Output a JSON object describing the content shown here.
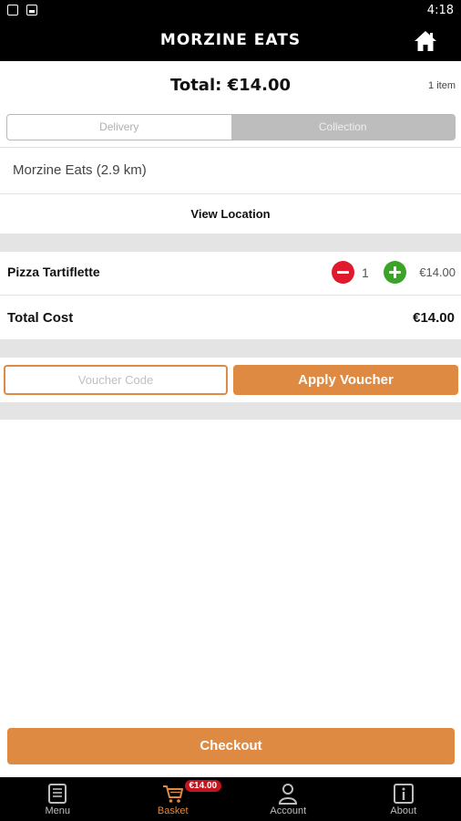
{
  "status_bar": {
    "time": "4:18"
  },
  "app_bar": {
    "title": "MORZINE EATS",
    "home_icon": "home-icon"
  },
  "summary": {
    "total_label": "Total: €14.00",
    "item_count": "1 item"
  },
  "order_type": {
    "options": [
      "Delivery",
      "Collection"
    ],
    "selected": "Collection"
  },
  "location": {
    "name": "Morzine Eats (2.9 km)",
    "view_label": "View Location"
  },
  "basket": {
    "items": [
      {
        "name": "Pizza Tartiflette",
        "quantity": "1",
        "price": "€14.00"
      }
    ],
    "total_cost_label": "Total Cost",
    "total_cost_value": "€14.00"
  },
  "voucher": {
    "placeholder": "Voucher Code",
    "apply_label": "Apply Voucher"
  },
  "checkout": {
    "label": "Checkout"
  },
  "tabs": [
    {
      "label": "Menu",
      "icon": "menu-book-icon"
    },
    {
      "label": "Basket",
      "icon": "cart-icon",
      "badge": "€14.00"
    },
    {
      "label": "Account",
      "icon": "account-icon"
    },
    {
      "label": "About",
      "icon": "info-icon"
    }
  ],
  "colors": {
    "accent": "#df8a42",
    "minus": "#e0192d",
    "plus": "#3aa328",
    "badge": "#c4141f"
  }
}
